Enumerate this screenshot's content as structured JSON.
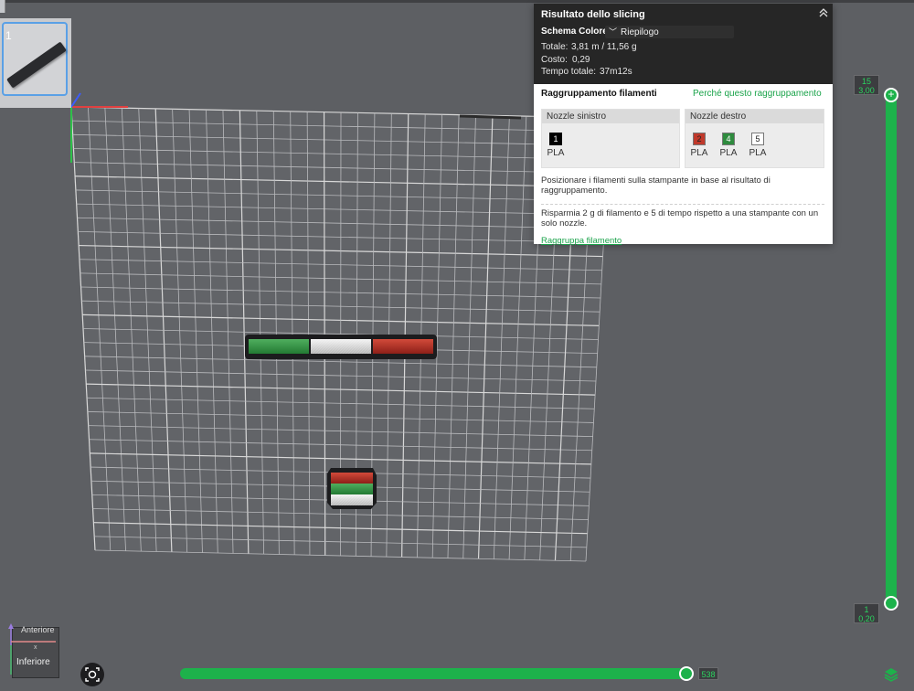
{
  "plate": {
    "number": "1"
  },
  "result_panel": {
    "title": "Risultato dello slicing",
    "color_scheme_label": "Schema Colore",
    "color_scheme_value": "Riepilogo",
    "total_label": "Totale:",
    "total_value": "3,81 m / 11,56 g",
    "cost_label": "Costo:",
    "cost_value": "0,29",
    "time_label": "Tempo totale:",
    "time_value": "37m12s",
    "grouping_title": "Raggruppamento filamenti",
    "why_link": "Perché questo raggruppamento",
    "nozzle_left": {
      "title": "Nozzle sinistro",
      "filaments": [
        {
          "id": "1",
          "material": "PLA",
          "color": "#000000"
        }
      ]
    },
    "nozzle_right": {
      "title": "Nozzle destro",
      "filaments": [
        {
          "id": "2",
          "material": "PLA",
          "color": "#c0392b"
        },
        {
          "id": "4",
          "material": "PLA",
          "color": "#2e8b3e"
        },
        {
          "id": "5",
          "material": "PLA",
          "color": "#ffffff"
        }
      ]
    },
    "position_hint": "Posizionare i filamenti sulla stampante in base al risultato di raggruppamento.",
    "savings_text": "Risparmia 2 g di filamento e 5 di tempo rispetto a una stampante con un solo nozzle.",
    "group_action": "Raggruppa filamento"
  },
  "layer_slider": {
    "top_layer": "15",
    "top_height": "3,00",
    "bottom_layer": "1",
    "bottom_height": "0,20"
  },
  "move_slider": {
    "value": "538"
  },
  "view_cube": {
    "top_label": "Anteriore",
    "face_label": "Inferiore"
  },
  "icons": {
    "collapse": "chevron-up-double-icon",
    "fit": "fit-view-icon",
    "layers": "layers-icon"
  },
  "colors": {
    "accent": "#1db24b",
    "panel_dark": "#262626",
    "background": "#5d5f63"
  }
}
